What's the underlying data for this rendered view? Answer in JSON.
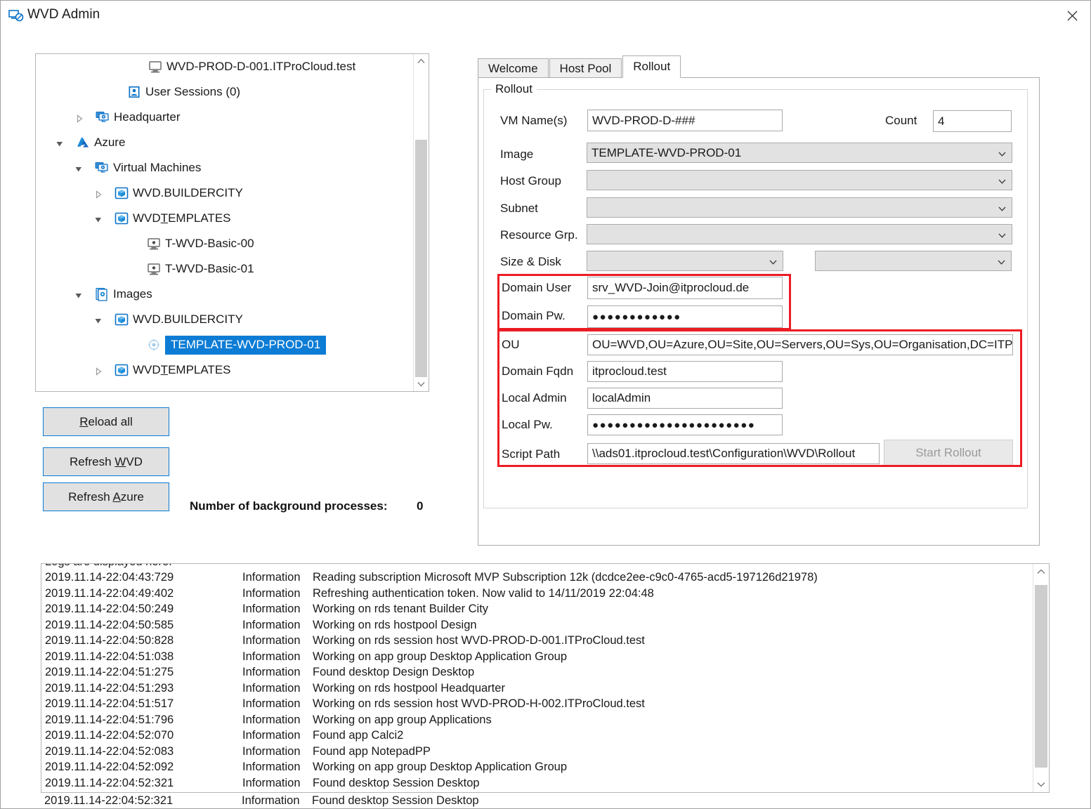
{
  "window": {
    "title": "WVD Admin",
    "icon": "remote-desktop-icon",
    "close_label": "✕",
    "accent_color": "#12497e"
  },
  "tree": {
    "nodes": [
      {
        "label": "WVD-PROD-D-001.ITProCloud.test",
        "icon": "monitor-icon",
        "indent": 160,
        "arrow": "none",
        "selected": false
      },
      {
        "label": "User Sessions (0)",
        "icon": "user-sessions-icon",
        "indent": 130,
        "arrow": "none",
        "selected": false
      },
      {
        "label": "Headquarter",
        "icon": "hostpool-icon",
        "indent": 85,
        "arrow": "collapsed",
        "selected": false
      },
      {
        "label": "Azure",
        "icon": "azure-icon",
        "indent": 57,
        "arrow": "expanded",
        "selected": false
      },
      {
        "label": "Virtual Machines",
        "icon": "hostpool-icon",
        "indent": 84,
        "arrow": "expanded",
        "selected": false
      },
      {
        "label": "WVD.BUILDERCITY",
        "icon": "cube-icon",
        "indent": 112,
        "arrow": "collapsed",
        "selected": false
      },
      {
        "label": "WVDTEMPLATES",
        "icon": "cube-icon",
        "indent": 112,
        "arrow": "expanded",
        "selected": false,
        "accel_index": 3
      },
      {
        "label": "T-WVD-Basic-00",
        "icon": "vm-icon",
        "indent": 158,
        "arrow": "none",
        "selected": false
      },
      {
        "label": "T-WVD-Basic-01",
        "icon": "vm-icon",
        "indent": 158,
        "arrow": "none",
        "selected": false
      },
      {
        "label": "Images",
        "icon": "images-icon",
        "indent": 84,
        "arrow": "expanded",
        "selected": false
      },
      {
        "label": "WVD.BUILDERCITY",
        "icon": "cube-icon",
        "indent": 112,
        "arrow": "expanded",
        "selected": false
      },
      {
        "label": "TEMPLATE-WVD-PROD-01",
        "icon": "image-template-icon",
        "indent": 158,
        "arrow": "none",
        "selected": true
      },
      {
        "label": "WVDTEMPLATES",
        "icon": "cube-icon",
        "indent": 112,
        "arrow": "collapsed",
        "selected": false,
        "accel_index": 3
      }
    ],
    "scrollbar": {
      "up": "chevron-up-icon",
      "down": "chevron-down-icon"
    }
  },
  "buttons": {
    "reload_all": {
      "text": "Reload all",
      "accel": "R"
    },
    "refresh_wvd": {
      "text": "Refresh WVD",
      "accel": "W"
    },
    "refresh_azure": {
      "text": "Refresh Azure",
      "accel": "A"
    }
  },
  "status": {
    "bg_processes_label": "Number of background processes:",
    "bg_processes_value": "0"
  },
  "tabs": [
    {
      "label": "Welcome",
      "active": false
    },
    {
      "label": "Host Pool",
      "active": false
    },
    {
      "label": "Rollout",
      "active": true
    }
  ],
  "rollout": {
    "group_title": "Rollout",
    "fields": {
      "vm_names": {
        "label": "VM Name(s)",
        "value": "WVD-PROD-D-###",
        "placeholder": ""
      },
      "count": {
        "label": "Count",
        "value": "4",
        "placeholder": ""
      },
      "image": {
        "label": "Image",
        "value": "TEMPLATE-WVD-PROD-01"
      },
      "host_group": {
        "label": "Host Group",
        "value": ""
      },
      "subnet": {
        "label": "Subnet",
        "value": ""
      },
      "resource_grp": {
        "label": "Resource Grp.",
        "value": ""
      },
      "size_disk": {
        "label": "Size & Disk",
        "size_value": "",
        "disk_value": ""
      },
      "domain_user": {
        "label": "Domain User",
        "value": "srv_WVD-Join@itprocloud.de"
      },
      "domain_pw": {
        "label": "Domain Pw.",
        "value": "●●●●●●●●●●●●"
      },
      "ou": {
        "label": "OU",
        "value": "OU=WVD,OU=Azure,OU=Site,OU=Servers,OU=Sys,OU=Organisation,DC=ITProC"
      },
      "domain_fqdn": {
        "label": "Domain Fqdn",
        "value": "itprocloud.test"
      },
      "local_admin": {
        "label": "Local Admin",
        "value": "localAdmin"
      },
      "local_pw": {
        "label": "Local Pw.",
        "value": "●●●●●●●●●●●●●●●●●●●●●●"
      },
      "script_path": {
        "label": "Script Path",
        "value": "\\\\ads01.itprocloud.test\\Configuration\\WVD\\Rollout"
      }
    },
    "start_button": {
      "label": "Start Rollout",
      "enabled": false
    },
    "highlight_color": "#ec1c24"
  },
  "logs": {
    "header": "Logs are displayed here.",
    "entries": [
      {
        "ts": "2019.11.14-22:04:43:729",
        "level": "Information",
        "msg": "Reading subscription Microsoft MVP Subscription 12k (dcdce2ee-c9c0-4765-acd5-197126d21978)"
      },
      {
        "ts": "2019.11.14-22:04:49:402",
        "level": "Information",
        "msg": "Refreshing authentication token. Now valid to 14/11/2019 22:04:48"
      },
      {
        "ts": "2019.11.14-22:04:50:249",
        "level": "Information",
        "msg": "Working on rds tenant Builder City"
      },
      {
        "ts": "2019.11.14-22:04:50:585",
        "level": "Information",
        "msg": "Working on rds hostpool Design"
      },
      {
        "ts": "2019.11.14-22:04:50:828",
        "level": "Information",
        "msg": "Working on rds session host WVD-PROD-D-001.ITProCloud.test"
      },
      {
        "ts": "2019.11.14-22:04:51:038",
        "level": "Information",
        "msg": "Working on app group Desktop Application Group"
      },
      {
        "ts": "2019.11.14-22:04:51:275",
        "level": "Information",
        "msg": "Found desktop Design Desktop"
      },
      {
        "ts": "2019.11.14-22:04:51:293",
        "level": "Information",
        "msg": "Working on rds hostpool Headquarter"
      },
      {
        "ts": "2019.11.14-22:04:51:517",
        "level": "Information",
        "msg": "Working on rds session host WVD-PROD-H-002.ITProCloud.test"
      },
      {
        "ts": "2019.11.14-22:04:51:796",
        "level": "Information",
        "msg": "Working on app group Applications"
      },
      {
        "ts": "2019.11.14-22:04:52:070",
        "level": "Information",
        "msg": "Found app Calci2"
      },
      {
        "ts": "2019.11.14-22:04:52:083",
        "level": "Information",
        "msg": "Found app NotepadPP"
      },
      {
        "ts": "2019.11.14-22:04:52:092",
        "level": "Information",
        "msg": "Working on app group Desktop Application Group"
      },
      {
        "ts": "2019.11.14-22:04:52:321",
        "level": "Information",
        "msg": "Found desktop Session Desktop"
      }
    ],
    "scrollbar": {
      "up": "chevron-up-icon",
      "down": "chevron-down-icon"
    }
  }
}
